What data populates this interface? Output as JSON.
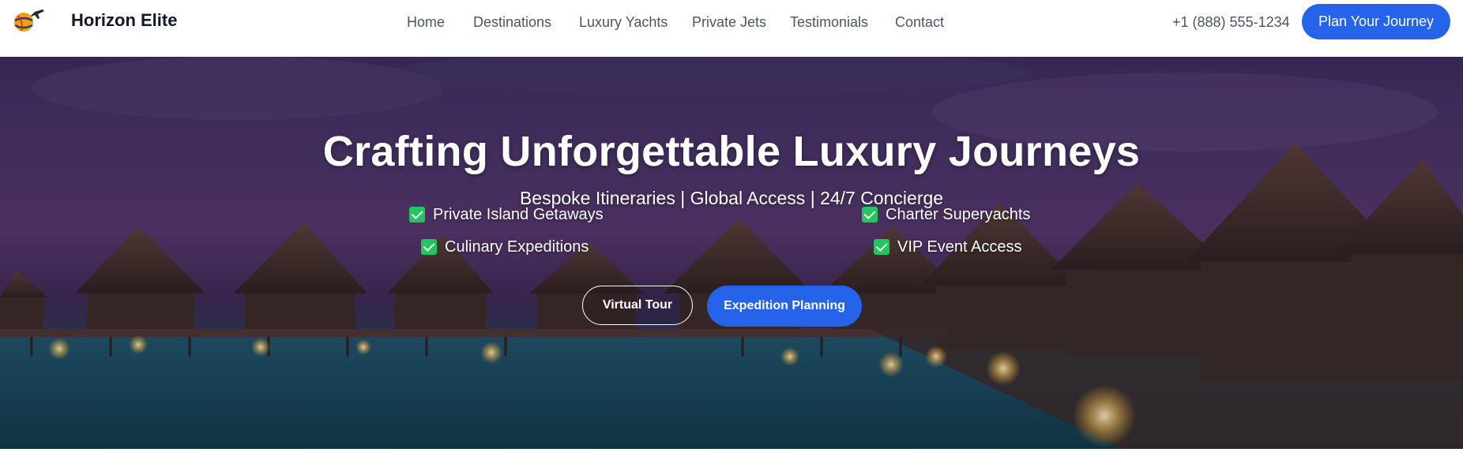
{
  "header": {
    "brand": "Horizon Elite",
    "logo_icon": "globe-airplane-icon",
    "nav": [
      "Home",
      "Destinations",
      "Luxury Yachts",
      "Private Jets",
      "Testimonials",
      "Contact"
    ],
    "phone": "+1 (888) 555-1234",
    "cta": "Plan Your Journey"
  },
  "hero": {
    "title": "Crafting Unforgettable Luxury Journeys",
    "subtitle": "Bespoke Itineraries | Global Access | 24/7 Concierge",
    "features": [
      "Private Island Getaways",
      "Charter Superyachts",
      "Culinary Expeditions",
      "VIP Event Access"
    ],
    "feature_icon": "check-icon",
    "buttons": {
      "secondary": "Virtual Tour",
      "primary": "Expedition Planning"
    }
  },
  "colors": {
    "accent": "#2563eb",
    "check": "#22c55e",
    "text_dark": "#111827",
    "nav_text": "#4b5563"
  }
}
